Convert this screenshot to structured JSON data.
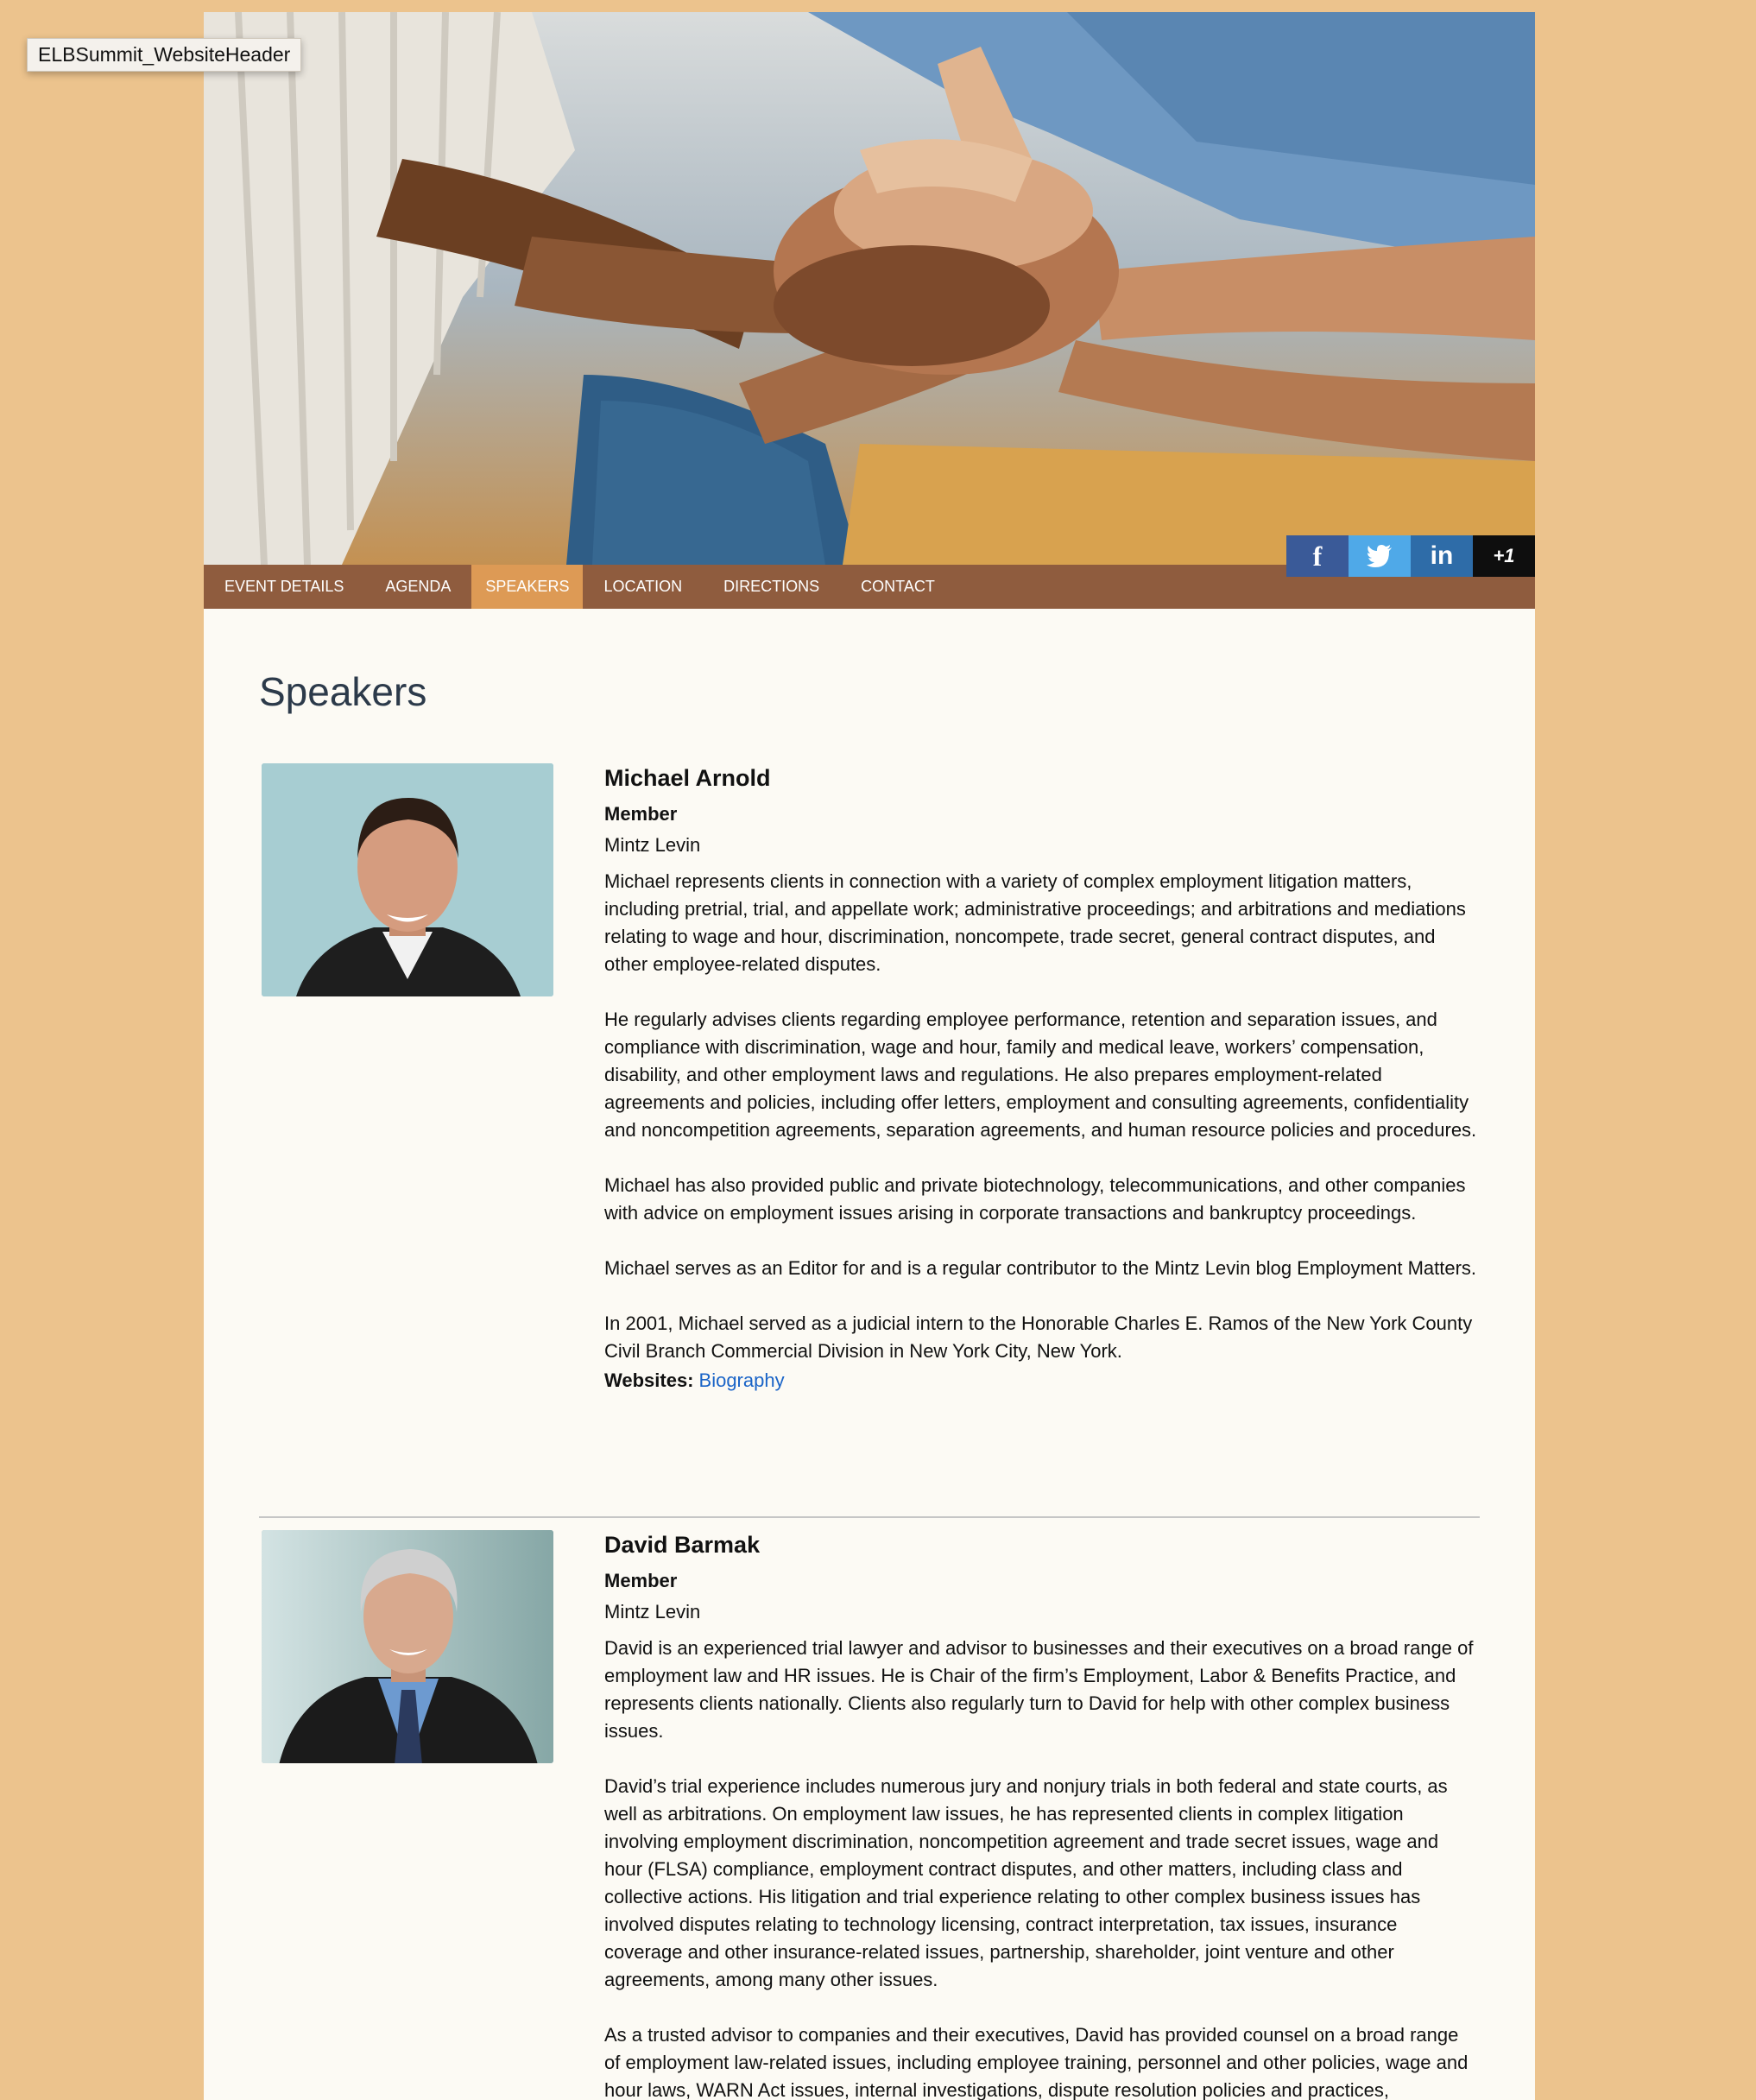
{
  "tooltip": "ELBSummit_WebsiteHeader",
  "hero": {
    "image": "hands-stacked-teamwork-photo"
  },
  "social": {
    "facebook": "f",
    "twitter_icon": "twitter-bird-icon",
    "linkedin": "in",
    "google_plus": "+1"
  },
  "nav": {
    "items": [
      "EVENT DETAILS",
      "AGENDA",
      "SPEAKERS",
      "LOCATION",
      "DIRECTIONS",
      "CONTACT"
    ],
    "active": "SPEAKERS"
  },
  "page_title": "Speakers",
  "speakers": [
    {
      "name": "Michael Arnold",
      "role": "Member",
      "org": "Mintz Levin",
      "bio": [
        "Michael represents clients in connection with a variety of complex employment litigation matters, including pretrial, trial, and appellate work; administrative proceedings; and arbitrations and mediations relating to wage and hour, discrimination, noncompete, trade secret, general contract disputes, and other employee-related disputes.",
        "He regularly advises clients regarding employee performance, retention and separation issues, and compliance with discrimination, wage and hour, family and medical leave, workers’ compensation, disability, and other employment laws and regulations. He also prepares employment-related agreements and policies, including offer letters, employment and consulting agreements, confidentiality and noncompetition agreements, separation agreements, and human resource policies and procedures.",
        "Michael has also provided public and private biotechnology, telecommunications, and other companies with advice on employment issues arising in corporate transactions and bankruptcy proceedings.",
        "Michael serves as an Editor for and is a regular contributor to the Mintz Levin blog Employment Matters.",
        "In 2001, Michael served as a judicial intern to the Honorable Charles E. Ramos of the New York County Civil Branch Commercial Division in New York City, New York."
      ],
      "websites_label": "Websites:",
      "websites_link": "Biography"
    },
    {
      "name": "David Barmak",
      "role": "Member",
      "org": "Mintz Levin",
      "bio": [
        "David is an experienced trial lawyer and advisor to businesses and their executives on a broad range of employment law and HR issues. He is Chair of the firm’s Employment, Labor & Benefits Practice, and represents clients nationally. Clients also regularly turn to David for help with other complex business issues.",
        "David’s trial experience includes numerous jury and nonjury trials in both federal and state courts, as well as arbitrations. On employment law issues, he has represented clients in complex litigation involving employment discrimination, noncompetition agreement and trade secret issues, wage and hour (FLSA) compliance, employment contract disputes, and other matters, including class and collective actions. His litigation and trial experience relating to other complex business issues has involved disputes relating to technology licensing, contract interpretation, tax issues, insurance coverage and other insurance-related issues, partnership, shareholder, joint venture and other agreements, among many other issues.",
        "As a trusted advisor to companies and their executives, David has provided counsel on a broad range of employment law-related issues, including employee training, personnel and other policies, wage and hour laws, WARN Act issues, internal investigations, dispute resolution policies and practices,"
      ]
    }
  ]
}
